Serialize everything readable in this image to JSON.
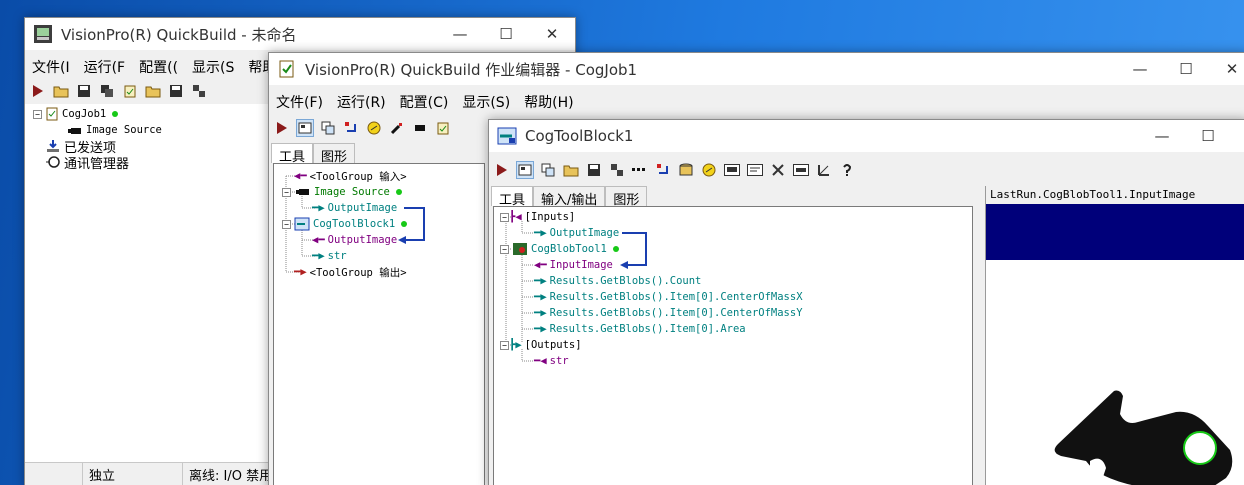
{
  "qb": {
    "title": "VisionPro(R) QuickBuild - 未命名",
    "menu": [
      "文件(I",
      "运行(F",
      "配置((",
      "显示(S",
      "帮助"
    ],
    "tree": [
      "CogJob1",
      "Image Source",
      "已发送项",
      "通讯管理器"
    ],
    "status": [
      "独立",
      "离线: I/O 禁用"
    ]
  },
  "editor": {
    "title": "VisionPro(R) QuickBuild 作业编辑器 - CogJob1",
    "menu": [
      "文件(F)",
      "运行(R)",
      "配置(C)",
      "显示(S)",
      "帮助(H)"
    ],
    "tabs": [
      "工具",
      "图形"
    ],
    "tree": [
      "<ToolGroup 输入>",
      "Image Source",
      "OutputImage",
      "CogToolBlock1",
      "OutputImage",
      "str",
      "<ToolGroup 输出>"
    ]
  },
  "block": {
    "title": "CogToolBlock1",
    "tabs": [
      "工具",
      "输入/输出",
      "图形"
    ],
    "tree": [
      "[Inputs]",
      "OutputImage",
      "CogBlobTool1",
      "InputImage",
      "Results.GetBlobs().Count",
      "Results.GetBlobs().Item[0].CenterOfMassX",
      "Results.GetBlobs().Item[0].CenterOfMassY",
      "Results.GetBlobs().Item[0].Area",
      "[Outputs]",
      "str"
    ],
    "image_title": "LastRun.CogBlobTool1.InputImage"
  },
  "window_buttons": {
    "minimize": "—",
    "maximize": "☐",
    "close": "✕"
  },
  "colors": {
    "desktop": "#1f6fd0",
    "teal": "#008080",
    "purple": "#800080",
    "image_band": "#00007a",
    "blob": "#111111",
    "ring": "#17c917"
  }
}
